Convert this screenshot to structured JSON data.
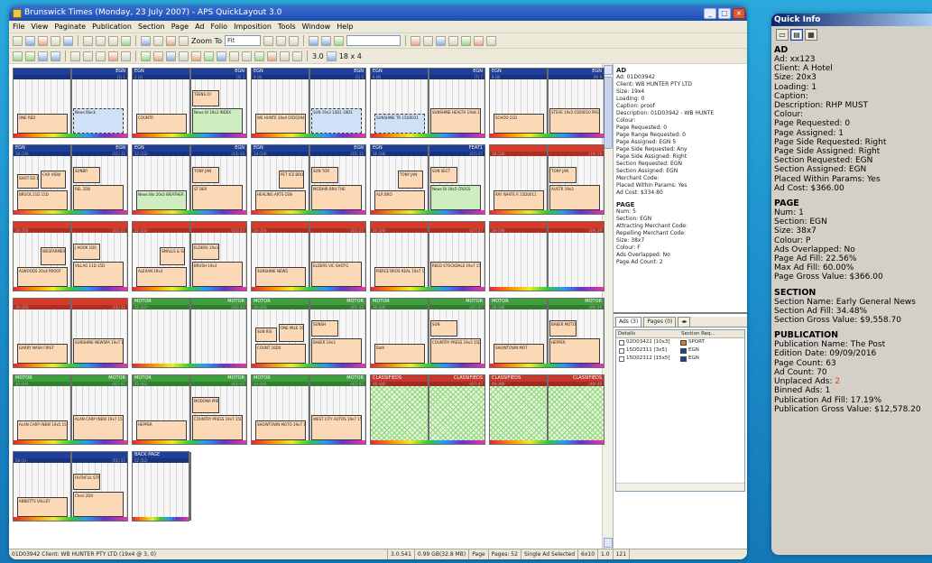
{
  "window": {
    "title": "Brunswick Times (Monday, 23 July 2007) - APS QuickLayout 3.0",
    "controls": [
      "_",
      "□",
      "×"
    ]
  },
  "menu": [
    "File",
    "View",
    "Paginate",
    "Publication",
    "Section",
    "Page",
    "Ad",
    "Folio",
    "Imposition",
    "Tools",
    "Window",
    "Help"
  ],
  "toolbar": {
    "zoom_label": "Zoom To",
    "zoom_value": "Fit",
    "size_value": "3.0",
    "grid_value": "18 x 4"
  },
  "canvas": {
    "spreads": [
      {
        "hdr_l": "",
        "hdr_r": "EGN",
        "sub_l": "",
        "sub_r": "(1) 1",
        "color": "#1e3f9c",
        "kind": "normal"
      },
      {
        "hdr_l": "EGN",
        "hdr_r": "EGN",
        "sub_l": "2 (2)",
        "sub_r": "(3) 3",
        "color": "#1e3f9c",
        "kind": "normal"
      },
      {
        "hdr_l": "EGN",
        "hdr_r": "EGN",
        "sub_l": "4 (4)",
        "sub_r": "(5) 5",
        "color": "#1e3f9c",
        "kind": "normal"
      },
      {
        "hdr_l": "EGN",
        "hdr_r": "EGN",
        "sub_l": "6 (6)",
        "sub_r": "(7) 7",
        "color": "#1e3f9c",
        "kind": "normal"
      },
      {
        "hdr_l": "EGN",
        "hdr_r": "EGN",
        "sub_l": "8 (8)",
        "sub_r": "(9) 9",
        "color": "#1e3f9c",
        "kind": "normal"
      },
      {
        "hdr_l": "EGN",
        "hdr_r": "EGN",
        "sub_l": "10 (10)",
        "sub_r": "(11) 11",
        "color": "#1e3f9c",
        "kind": "normal"
      },
      {
        "hdr_l": "EGN",
        "hdr_r": "EGN",
        "sub_l": "12 (12)",
        "sub_r": "(13) 13",
        "color": "#1e3f9c",
        "kind": "normal"
      },
      {
        "hdr_l": "EGN",
        "hdr_r": "EGN",
        "sub_l": "14 (14)",
        "sub_r": "(15) 15",
        "color": "#1e3f9c",
        "kind": "normal"
      },
      {
        "hdr_l": "EGN",
        "hdr_r": "FEAT1",
        "sub_l": "16 (16)",
        "sub_r": "(17) 17",
        "color": "#1e3f9c",
        "kind": "normal"
      },
      {
        "hdr_l": "",
        "hdr_r": "",
        "sub_l": "18 (18)",
        "sub_r": "(19) 19",
        "color": "#d83a2a",
        "kind": "normal"
      },
      {
        "hdr_l": "",
        "hdr_r": "",
        "sub_l": "20 (20)",
        "sub_r": "(21) 21",
        "color": "#d83a2a",
        "kind": "normal"
      },
      {
        "hdr_l": "",
        "hdr_r": "",
        "sub_l": "22 (22)",
        "sub_r": "(23) 23",
        "color": "#d83a2a",
        "kind": "normal"
      },
      {
        "hdr_l": "",
        "hdr_r": "",
        "sub_l": "24 (24)",
        "sub_r": "(25) 25",
        "color": "#d83a2a",
        "kind": "normal"
      },
      {
        "hdr_l": "",
        "hdr_r": "",
        "sub_l": "26 (26)",
        "sub_r": "(27) 27",
        "color": "#d83a2a",
        "kind": "normal"
      },
      {
        "hdr_l": "",
        "hdr_r": "",
        "sub_l": "28 (28)",
        "sub_r": "(29) 29",
        "color": "#d83a2a",
        "kind": "normal"
      },
      {
        "hdr_l": "",
        "hdr_r": "",
        "sub_l": "30 (30)",
        "sub_r": "(31) 31",
        "color": "#d83a2a",
        "kind": "normal"
      },
      {
        "hdr_l": "MOTOR",
        "hdr_r": "MOTOR",
        "sub_l": "32 (32)",
        "sub_r": "(33) 33",
        "color": "#3f9f3f",
        "kind": "normal"
      },
      {
        "hdr_l": "MOTOR",
        "hdr_r": "MOTOR",
        "sub_l": "34 (34)",
        "sub_r": "(35) 35",
        "color": "#3f9f3f",
        "kind": "normal"
      },
      {
        "hdr_l": "MOTOR",
        "hdr_r": "MOTOR",
        "sub_l": "36 (36)",
        "sub_r": "(37) 37",
        "color": "#3f9f3f",
        "kind": "normal"
      },
      {
        "hdr_l": "MOTOR",
        "hdr_r": "MOTOR",
        "sub_l": "38 (38)",
        "sub_r": "(39) 39",
        "color": "#3f9f3f",
        "kind": "normal"
      },
      {
        "hdr_l": "MOTOR",
        "hdr_r": "MOTOR",
        "sub_l": "40 (40)",
        "sub_r": "(41) 41",
        "color": "#3f9f3f",
        "kind": "normal"
      },
      {
        "hdr_l": "MOTOR",
        "hdr_r": "MOTOR",
        "sub_l": "42 (42)",
        "sub_r": "(43) 43",
        "color": "#3f9f3f",
        "kind": "normal"
      },
      {
        "hdr_l": "MOTOR",
        "hdr_r": "MOTOR",
        "sub_l": "44 (44)",
        "sub_r": "(45) 45",
        "color": "#3f9f3f",
        "kind": "normal"
      },
      {
        "hdr_l": "CLASSIFIEDS",
        "hdr_r": "CLASSIFIEDS",
        "sub_l": "46 (46)",
        "sub_r": "(47) 47",
        "color": "#c8372c",
        "kind": "classified"
      },
      {
        "hdr_l": "CLASSIFIEDS",
        "hdr_r": "CLASSIFIEDS",
        "sub_l": "48 (48)",
        "sub_r": "(49) 49",
        "color": "#c8372c",
        "kind": "classified"
      },
      {
        "hdr_l": "",
        "hdr_r": "",
        "sub_l": "50 (1)",
        "sub_r": "(51) 51",
        "color": "#1e3f9c",
        "kind": "normal"
      },
      {
        "hdr_l": "BACK PAGE",
        "hdr_r": "",
        "sub_l": "52 (52)",
        "sub_r": "",
        "color": "#1e3f9c",
        "kind": "normal"
      }
    ],
    "ads": [
      {
        "s": 0,
        "t": "News Block",
        "c": "blue"
      },
      {
        "s": 0,
        "t": "ONE RED",
        "c": "peach"
      },
      {
        "s": 1,
        "t": "News Bl 19x3 INDEX",
        "c": "green"
      },
      {
        "s": 1,
        "t": "COUNTR",
        "c": "peach"
      },
      {
        "s": 1,
        "t": "TEENS OI",
        "c": "peach"
      },
      {
        "s": 2,
        "t": "SUN 19x3 14D1 18D1",
        "c": "blue"
      },
      {
        "s": 2,
        "t": "WE HUNTE 19x4 01D03942 proof",
        "c": "peach"
      },
      {
        "s": 3,
        "t": "SUNSHINE HEALTH 19x8 15D0038 copy sent to printer",
        "c": "peach"
      },
      {
        "s": 3,
        "t": "SUNSHINE TR 15D0021",
        "c": "blue"
      },
      {
        "s": 4,
        "t": "STEVE 19x5 01D0010 PAGE 9",
        "c": "peach"
      },
      {
        "s": 4,
        "t": "SCHOO 21D",
        "c": "peach"
      },
      {
        "s": 5,
        "t": "REL 2D8",
        "c": "peach"
      },
      {
        "s": 5,
        "t": "BRUCK 21D 15D",
        "c": "peach"
      },
      {
        "s": 5,
        "t": "SUNBR",
        "c": "peach"
      },
      {
        "s": 5,
        "t": "CAR VIEW",
        "c": "peach"
      },
      {
        "s": 5,
        "t": "SHOT ED 19x6",
        "c": "peach"
      },
      {
        "s": 6,
        "t": "ST BER",
        "c": "peach"
      },
      {
        "s": 6,
        "t": "News Blo 20x3 WEATHER",
        "c": "green"
      },
      {
        "s": 6,
        "t": "TONY JAN",
        "c": "peach"
      },
      {
        "s": 7,
        "t": "MODHIR BRU THE",
        "c": "peach"
      },
      {
        "s": 7,
        "t": "HEALING ARTS CEN",
        "c": "peach"
      },
      {
        "s": 7,
        "t": "SUN TOR",
        "c": "peach"
      },
      {
        "s": 7,
        "t": "PET ICE BRO",
        "c": "peach"
      },
      {
        "s": 8,
        "t": "News Bl 19x5 CROSS",
        "c": "green"
      },
      {
        "s": 8,
        "t": "ALR BRO",
        "c": "peach"
      },
      {
        "s": 8,
        "t": "SUN SECT",
        "c": "peach"
      },
      {
        "s": 8,
        "t": "TONY JAN",
        "c": "peach"
      },
      {
        "s": 9,
        "t": "AUSTR 19x3",
        "c": "peach"
      },
      {
        "s": 9,
        "t": "RAY WHITE R 15D0011",
        "c": "peach"
      },
      {
        "s": 9,
        "t": "TONY JAN",
        "c": "peach"
      },
      {
        "s": 10,
        "t": "VILLAG 11D 15D",
        "c": "peach"
      },
      {
        "s": 10,
        "t": "ALWOODS 20x4 PROOF",
        "c": "peach"
      },
      {
        "s": 10,
        "t": "J HOOK 1D0",
        "c": "peach"
      },
      {
        "s": 10,
        "t": "WESFARMERS LAND",
        "c": "peach"
      },
      {
        "s": 11,
        "t": "BRUSH 19x3",
        "c": "peach"
      },
      {
        "s": 11,
        "t": "ALEXAN 19x3",
        "c": "peach"
      },
      {
        "s": 11,
        "t": "ELDERS 19x3",
        "c": "peach"
      },
      {
        "s": 11,
        "t": "SMALLS & SCOLLARD",
        "c": "peach"
      },
      {
        "s": 12,
        "t": "ELDERS VIC SHOTG",
        "c": "peach"
      },
      {
        "s": 12,
        "t": "SUNSHINE NEWS",
        "c": "peach"
      },
      {
        "s": 13,
        "t": "REED STOCKDALE 19x7 15D0102",
        "c": "peach"
      },
      {
        "s": 13,
        "t": "PIERCE BROS REAL 19x7 15D0417",
        "c": "peach"
      },
      {
        "s": 15,
        "t": "SUNSHINE NEWSPA 19x7 15D0230 PROPERTY GUIDE",
        "c": "peach"
      },
      {
        "s": 15,
        "t": "GARRY NASH FIRST",
        "c": "peach"
      },
      {
        "s": 17,
        "t": "BAKER 19x3",
        "c": "peach"
      },
      {
        "s": 17,
        "t": "COUNT 16D0",
        "c": "peach"
      },
      {
        "s": 17,
        "t": "SUNSH",
        "c": "peach"
      },
      {
        "s": 17,
        "t": "ONE MILE 16D0",
        "c": "peach"
      },
      {
        "s": 17,
        "t": "SUN RIS",
        "c": "peach"
      },
      {
        "s": 18,
        "t": "COUNTRY PRESS 19x3 15D0410 Toyota",
        "c": "peach"
      },
      {
        "s": 18,
        "t": "Bath",
        "c": "peach"
      },
      {
        "s": 18,
        "t": "SUN",
        "c": "peach"
      },
      {
        "s": 19,
        "t": "HEPPER",
        "c": "peach"
      },
      {
        "s": 19,
        "t": "SHOWTOWN MOT",
        "c": "peach"
      },
      {
        "s": 19,
        "t": "BAKER MOTORS",
        "c": "peach"
      },
      {
        "s": 20,
        "t": "ALAN CARP (NEW 19x7 15D0204 proof",
        "c": "peach"
      },
      {
        "s": 20,
        "t": "ALAN CARP (NEW 19x5 15D0000",
        "c": "peach"
      },
      {
        "s": 21,
        "t": "COUNTRY PRESS 19x7 15D0410 Toyota",
        "c": "peach"
      },
      {
        "s": 21,
        "t": "HEPPER",
        "c": "peach"
      },
      {
        "s": 21,
        "t": "MODONA PRESTI",
        "c": "peach"
      },
      {
        "s": 22,
        "t": "WEST CITY AUTOS 19x7 15D0306 proof",
        "c": "peach"
      },
      {
        "s": 22,
        "t": "SHOWTOWN MOTO 19x7 15D0309 proof",
        "c": "peach"
      },
      {
        "s": 25,
        "t": "Cheri 2D0",
        "c": "peach"
      },
      {
        "s": 25,
        "t": "ABBOTTS VALLEY",
        "c": "peach"
      },
      {
        "s": 25,
        "t": "FAITHFUL STREET",
        "c": "peach"
      }
    ]
  },
  "properties": {
    "ad": {
      "heading": "AD",
      "rows": [
        "Ad: 01D03942",
        "Client: WB HUNTER PTY LTD",
        "Size: 19x4",
        "Loading: 0",
        "Caption: proof",
        "Description: 01D03942 - WB HUNTE",
        "Colour:",
        "Page Requested: 0",
        "Page Range Requested: 0",
        "Page Assigned: EGN 5",
        "Page Side Requested: Any",
        "Page Side Assigned: Right",
        "Section Requested: EGN",
        "Section Assigned: EGN",
        "Merchant Code:",
        "Placed Within Params: Yes",
        "Ad Cost: $334.80"
      ]
    },
    "page": {
      "heading": "PAGE",
      "rows": [
        "Num: 5",
        "Section: EGN",
        "Attracting Merchant Code:",
        "Repelling Merchant Code:",
        "Size: 38x7",
        "Colour: F",
        "Ads Overlapped: No",
        "Page Ad Count: 2"
      ]
    }
  },
  "tabs": {
    "ads": "Ads (3)",
    "pages": "Pages (0)"
  },
  "adlist": {
    "columns": [
      "Details",
      "Section Req..."
    ],
    "rows": [
      {
        "details": "02D03422 [10x3]",
        "section": "SPORT",
        "color": "#e07a1a"
      },
      {
        "details": "15D02311 [3x5]",
        "section": "EGN",
        "color": "#1e3f9c"
      },
      {
        "details": "15D02312 [15x5]",
        "section": "EGN",
        "color": "#1e3f9c"
      }
    ]
  },
  "status": {
    "left": "01D03942 Client: WB HUNTER PTY LTD (19x4 @ 3, 0)",
    "version": "3.0.541",
    "memory": "0.99 GB(32.8 MB)",
    "page_label": "Page",
    "pages": "Pages: 52",
    "selection": "Single Ad Selected",
    "grid": "6x10",
    "zoom": "1.0",
    "count": "121"
  },
  "quickinfo": {
    "title": "Quick Info",
    "ad": {
      "heading": "AD",
      "rows": [
        "Ad: xx123",
        "Client: A Hotel",
        "Size: 20x3",
        "Loading: 1",
        "Caption:",
        "Description: RHP MUST",
        "Colour:",
        "Page Requested: 0",
        "Page Assigned: 1",
        "Page Side Requested: Right",
        "Page Side Assigned: Right",
        "Section Requested: EGN",
        "Section Assigned: EGN",
        "Placed Within Params: Yes",
        "Ad Cost: $366.00"
      ]
    },
    "page": {
      "heading": "PAGE",
      "rows": [
        "Num: 1",
        "Section: EGN",
        "Size: 38x7",
        "Colour: P",
        "Ads Overlapped: No",
        "Page Ad Fill: 22.56%",
        "Max Ad Fill: 60.00%",
        "Page Gross Value: $366.00"
      ]
    },
    "section": {
      "heading": "SECTION",
      "rows": [
        "Section Name: Early General News",
        "Section Ad Fill: 34.48%",
        "Section Gross Value: $9,558.70"
      ]
    },
    "publication": {
      "heading": "PUBLICATION",
      "rows": [
        "Publication Name: The Post",
        "Edition Date: 09/09/2016",
        "Page Count: 63",
        "Ad Count: 70"
      ],
      "unplaced_label": "Unplaced Ads: ",
      "unplaced_value": "2",
      "rows2": [
        "Binned Ads: 1",
        "Publication Ad Fill: 17.19%",
        "Publication Gross Value: $12,578.20"
      ]
    }
  }
}
